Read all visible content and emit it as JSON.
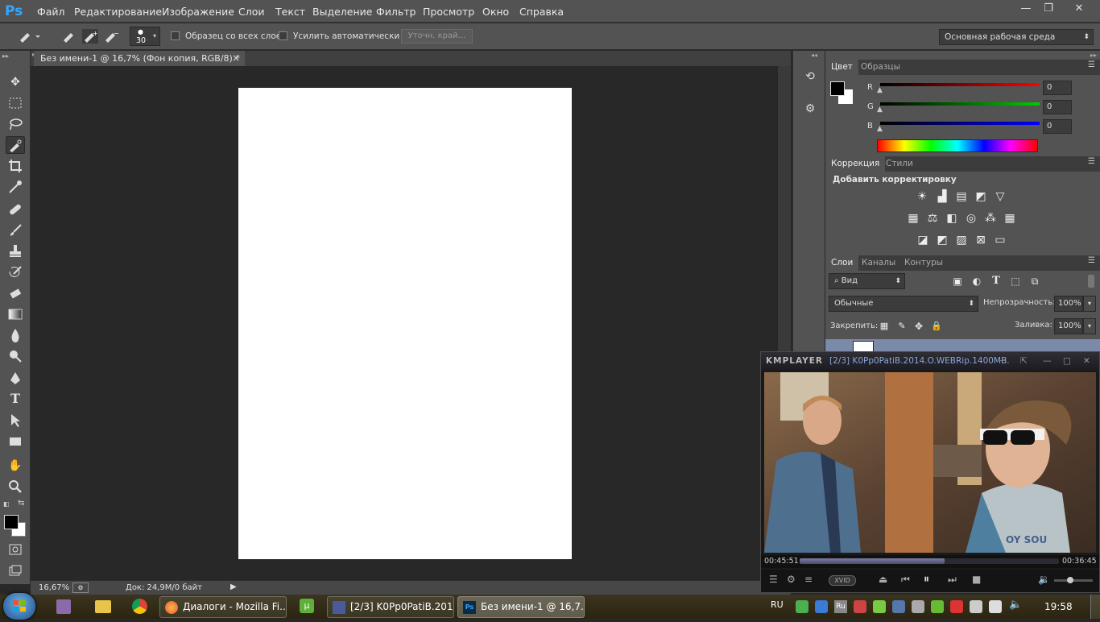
{
  "app": {
    "logo": "Ps"
  },
  "menu": [
    "Файл",
    "Редактирование",
    "Изображение",
    "Слои",
    "Текст",
    "Выделение",
    "Фильтр",
    "Просмотр",
    "Окно",
    "Справка"
  ],
  "window_controls": {
    "minimize": "—",
    "restore": "❐",
    "close": "✕"
  },
  "options": {
    "brush_size": "30",
    "sample_all_layers": "Образец со всех слоев",
    "auto_enhance": "Усилить автоматически",
    "refine_edge": "Уточн. край...",
    "workspace": "Основная рабочая среда"
  },
  "document": {
    "tab_title": "Без имени-1 @ 16,7% (Фон копия, RGB/8) *",
    "tab_close": "×",
    "zoom": "16,67%",
    "doc_info": "Док: 24,9M/0 байт"
  },
  "color_panel": {
    "tabs": [
      "Цвет",
      "Образцы"
    ],
    "channels": [
      {
        "label": "R",
        "value": "0",
        "color": "#ff0000"
      },
      {
        "label": "G",
        "value": "0",
        "color": "#00cc00"
      },
      {
        "label": "B",
        "value": "0",
        "color": "#0000ff"
      }
    ],
    "foreground": "#000000",
    "background": "#ffffff"
  },
  "adjust_panel": {
    "tabs": [
      "Коррекция",
      "Стили"
    ],
    "heading": "Добавить корректировку"
  },
  "layers_panel": {
    "tabs": [
      "Слои",
      "Каналы",
      "Контуры"
    ],
    "filter": "Вид",
    "blend_mode": "Обычные",
    "opacity_label": "Непрозрачность:",
    "opacity": "100%",
    "lock_label": "Закрепить:",
    "fill_label": "Заливка:",
    "fill": "100%"
  },
  "kmplayer": {
    "logo": "KMPLAYER",
    "title": "[2/3] K0Pp0PatiB.2014.O.WEBRip.1400MB.",
    "elapsed": "00:45:51",
    "remaining": "00:36:45",
    "progress": 0.56,
    "codec": "XVID"
  },
  "taskbar": {
    "tasks": [
      {
        "label": "Диалоги - Mozilla Fi...",
        "icon": "firefox-icon"
      },
      {
        "label": "[2/3] K0Pp0PatiB.201...",
        "icon": "kmplayer-icon"
      },
      {
        "label": "Без имени-1 @ 16,7...",
        "icon": "photoshop-icon"
      }
    ],
    "lang": "RU",
    "tray_lang": "Ru",
    "time": "19:58"
  }
}
